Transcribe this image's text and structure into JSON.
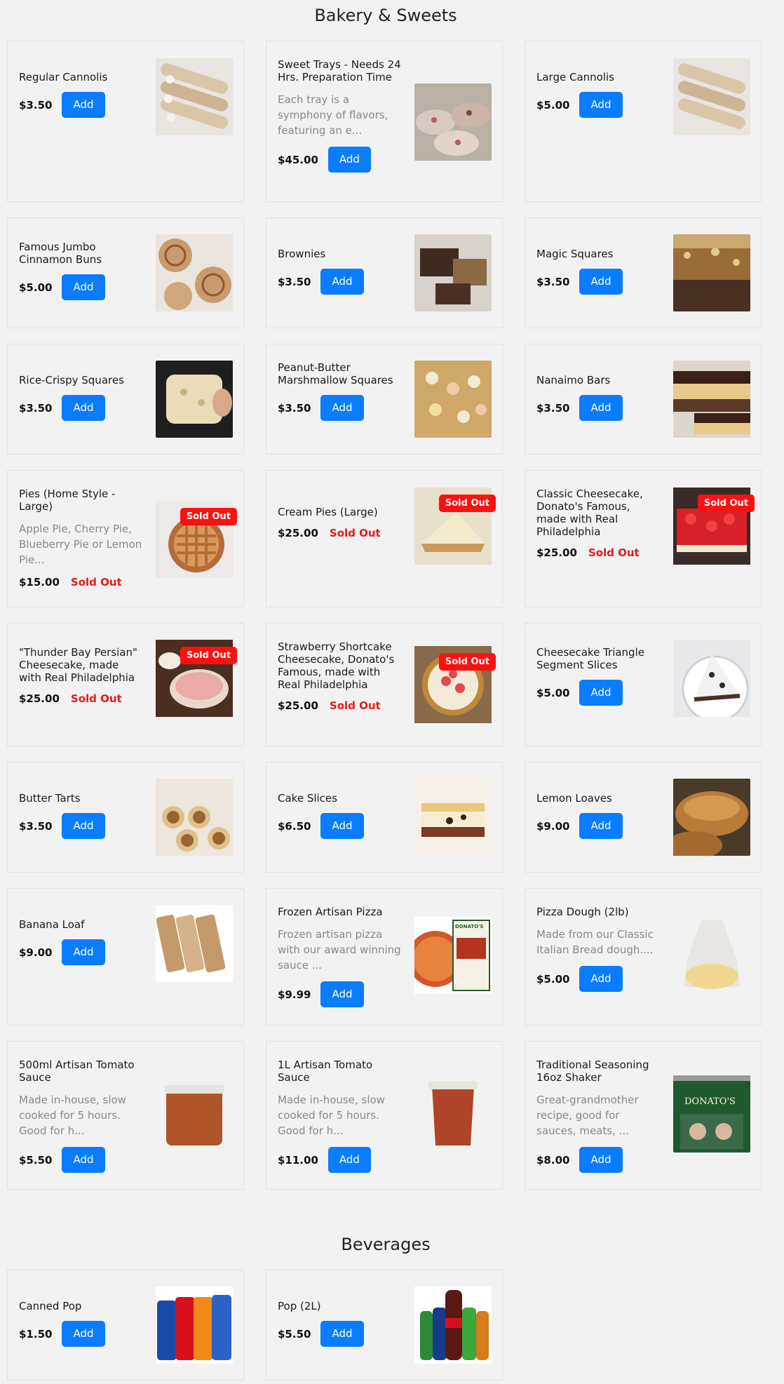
{
  "sections": {
    "bakery": {
      "title": "Bakery & Sweets"
    },
    "beverages": {
      "title": "Beverages"
    }
  },
  "labels": {
    "add": "Add",
    "sold_out": "Sold Out"
  },
  "items": {
    "regular_cannolis": {
      "name": "Regular Cannolis",
      "price": "$3.50",
      "image": "cannoli-image"
    },
    "sweet_trays": {
      "name": "Sweet Trays - Needs 24 Hrs. Preparation Time",
      "desc": "Each tray is a symphony of flavors, featuring an e...",
      "price": "$45.00",
      "image": "sweet-tray-image"
    },
    "large_cannolis": {
      "name": "Large Cannolis",
      "price": "$5.00",
      "image": "cannoli-image"
    },
    "cinnamon_buns": {
      "name": "Famous Jumbo Cinnamon Buns",
      "price": "$5.00",
      "image": "cinnamon-bun-image"
    },
    "brownies": {
      "name": "Brownies",
      "price": "$3.50",
      "image": "brownie-image"
    },
    "magic_squares": {
      "name": "Magic Squares",
      "price": "$3.50",
      "image": "magic-square-image"
    },
    "rice_crispy": {
      "name": "Rice-Crispy Squares",
      "price": "$3.50",
      "image": "rice-crispy-image"
    },
    "pb_marshmallow": {
      "name": "Peanut-Butter Marshmallow Squares",
      "price": "$3.50",
      "image": "marshmallow-square-image"
    },
    "nanaimo": {
      "name": "Nanaimo Bars",
      "price": "$3.50",
      "image": "nanaimo-bar-image"
    },
    "pies": {
      "name": "Pies (Home Style - Large)",
      "desc": "Apple Pie, Cherry Pie, Blueberry Pie or Lemon Pie...",
      "price": "$15.00",
      "image": "pie-image"
    },
    "cream_pies": {
      "name": "Cream Pies (Large)",
      "price": "$25.00",
      "image": "cream-pie-image"
    },
    "classic_cheesecake": {
      "name": "Classic Cheesecake, Donato's Famous, made with Real Philadelphia",
      "price": "$25.00",
      "image": "cherry-cheesecake-image"
    },
    "thunder_bay": {
      "name": "\"Thunder Bay Persian\" Cheesecake, made with Real Philadelphia",
      "price": "$25.00",
      "image": "persian-cheesecake-image"
    },
    "strawberry_shortcake": {
      "name": "Strawberry Shortcake Cheesecake, Donato's Famous, made with Real Philadelphia",
      "price": "$25.00",
      "image": "strawberry-cheesecake-image"
    },
    "cheesecake_triangle": {
      "name": "Cheesecake Triangle Segment Slices",
      "price": "$5.00",
      "image": "cheesecake-slice-image"
    },
    "butter_tarts": {
      "name": "Butter Tarts",
      "price": "$3.50",
      "image": "butter-tart-image"
    },
    "cake_slices": {
      "name": "Cake Slices",
      "price": "$6.50",
      "image": "cake-slice-image"
    },
    "lemon_loaves": {
      "name": "Lemon Loaves",
      "price": "$9.00",
      "image": "lemon-loaf-image"
    },
    "banana_loaf": {
      "name": "Banana Loaf",
      "price": "$9.00",
      "image": "banana-loaf-image"
    },
    "frozen_pizza": {
      "name": "Frozen Artisan Pizza",
      "desc": "Frozen artisan pizza with our award winning sauce ...",
      "price": "$9.99",
      "image": "frozen-pizza-image"
    },
    "pizza_dough": {
      "name": "Pizza Dough (2lb)",
      "desc": "Made from our Classic Italian Bread dough....",
      "price": "$5.00",
      "image": "pizza-dough-image"
    },
    "sauce_500": {
      "name": "500ml Artisan Tomato Sauce",
      "desc": "Made in-house, slow cooked for 5 hours. Good for h...",
      "price": "$5.50",
      "image": "tomato-sauce-image"
    },
    "sauce_1l": {
      "name": "1L Artisan Tomato Sauce",
      "desc": "Made in-house, slow cooked for 5 hours. Good for h...",
      "price": "$11.00",
      "image": "tomato-sauce-image"
    },
    "seasoning": {
      "name": "Traditional Seasoning 16oz Shaker",
      "desc": "Great-grandmother recipe, good for sauces, meats, ...",
      "price": "$8.00",
      "image": "seasoning-shaker-image"
    },
    "canned_pop": {
      "name": "Canned Pop",
      "price": "$1.50",
      "image": "soda-cans-image"
    },
    "pop_2l": {
      "name": "Pop (2L)",
      "price": "$5.50",
      "image": "soda-bottles-image"
    }
  },
  "brand_text": {
    "tin_label": "DONATO'S",
    "pizza_box": "DONATO'S"
  },
  "colors": {
    "accent": "#0a7cff",
    "sold_out": "#e31b1b",
    "badge": "#ff1010",
    "background": "#f3f2f2"
  }
}
